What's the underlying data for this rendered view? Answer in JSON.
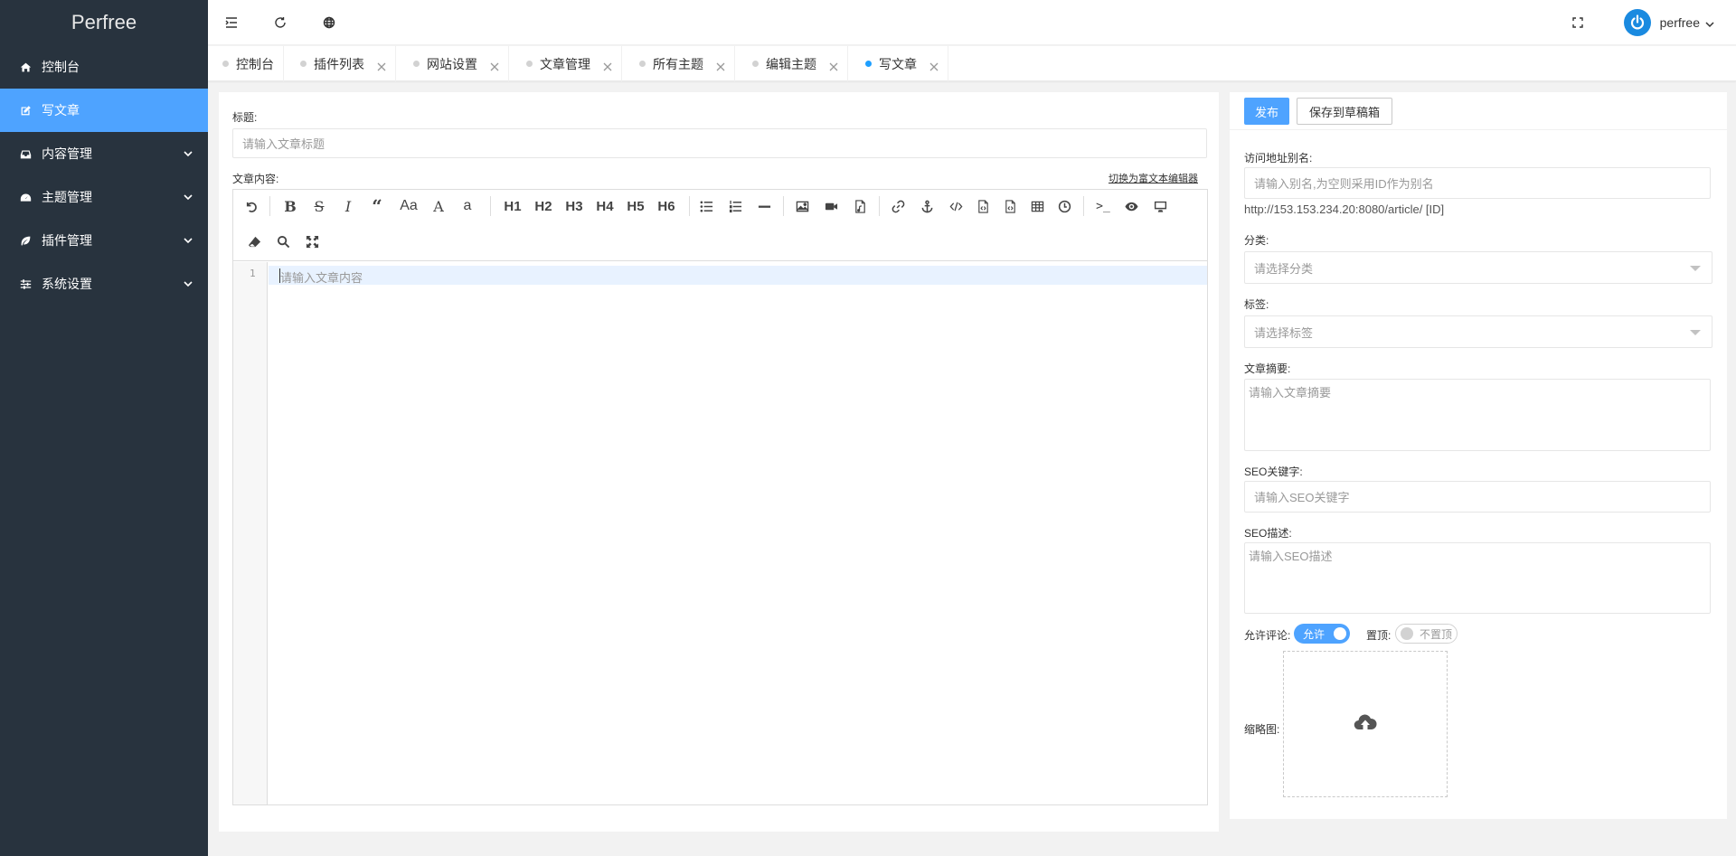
{
  "app": {
    "brand": "Perfree"
  },
  "sidebar": {
    "items": [
      {
        "label": "控制台",
        "icon": "home-icon"
      },
      {
        "label": "写文章",
        "icon": "edit-icon",
        "active": true
      },
      {
        "label": "内容管理",
        "icon": "inbox-icon",
        "expandable": true
      },
      {
        "label": "主题管理",
        "icon": "dashboard-icon",
        "expandable": true
      },
      {
        "label": "插件管理",
        "icon": "leaf-icon",
        "expandable": true
      },
      {
        "label": "系统设置",
        "icon": "sliders-icon",
        "expandable": true
      }
    ]
  },
  "header": {
    "user_name": "perfree",
    "icons": [
      "menu-toggle-icon",
      "refresh-icon",
      "globe-icon",
      "fullscreen-icon",
      "power-avatar-icon"
    ]
  },
  "tabs": [
    {
      "label": "控制台",
      "closable": false
    },
    {
      "label": "插件列表",
      "closable": true
    },
    {
      "label": "网站设置",
      "closable": true
    },
    {
      "label": "文章管理",
      "closable": true
    },
    {
      "label": "所有主题",
      "closable": true
    },
    {
      "label": "编辑主题",
      "closable": true
    },
    {
      "label": "写文章",
      "closable": true,
      "active": true
    }
  ],
  "form": {
    "title_label": "标题:",
    "title_placeholder": "请输入文章标题",
    "content_label": "文章内容:",
    "switch_editor_link": "切换为富文本编辑器",
    "editor": {
      "line_number": "1",
      "placeholder": "请输入文章内容",
      "toolbar_headings": [
        "H1",
        "H2",
        "H3",
        "H4",
        "H5",
        "H6"
      ]
    }
  },
  "side_panel": {
    "publish_label": "发布",
    "draft_label": "保存到草稿箱",
    "alias_label": "访问地址别名:",
    "alias_placeholder": "请输入别名,为空则采用ID作为别名",
    "url_text": "http://153.153.234.20:8080/article/ [ID]",
    "category_label": "分类:",
    "category_placeholder": "请选择分类",
    "tag_label": "标签:",
    "tag_placeholder": "请选择标签",
    "summary_label": "文章摘要:",
    "summary_placeholder": "请输入文章摘要",
    "seo_keywords_label": "SEO关键字:",
    "seo_keywords_placeholder": "请输入SEO关键字",
    "seo_desc_label": "SEO描述:",
    "seo_desc_placeholder": "请输入SEO描述",
    "comment_label": "允许评论:",
    "comment_switch_text": "允许",
    "comment_on": true,
    "top_label": "置顶:",
    "top_switch_text": "不置顶",
    "top_on": false,
    "thumbnail_label": "缩略图:"
  },
  "colors": {
    "sidebar_bg": "#28333e",
    "accent": "#4ea3ff"
  }
}
